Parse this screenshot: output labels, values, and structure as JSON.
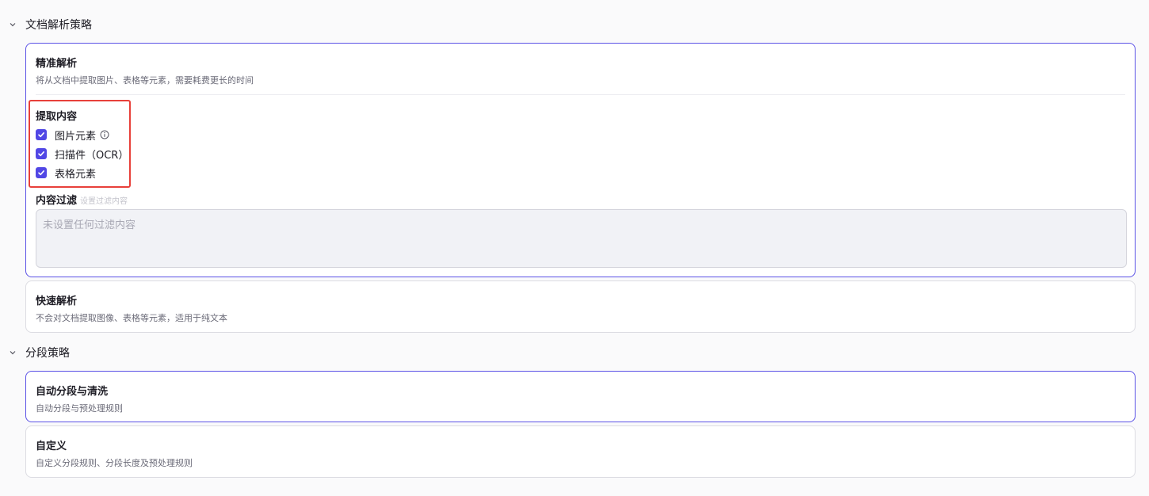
{
  "parse_section": {
    "title": "文档解析策略",
    "precise": {
      "title": "精准解析",
      "desc": "将从文档中提取图片、表格等元素，需要耗费更长的时间",
      "extract": {
        "title": "提取内容",
        "options": [
          {
            "label": "图片元素",
            "checked": true
          },
          {
            "label": "扫描件（OCR）",
            "checked": true
          },
          {
            "label": "表格元素",
            "checked": true
          }
        ]
      },
      "filter": {
        "title": "内容过滤",
        "hint": "设置过滤内容",
        "placeholder": "未设置任何过滤内容"
      }
    },
    "fast": {
      "title": "快速解析",
      "desc": "不会对文档提取图像、表格等元素，适用于纯文本"
    }
  },
  "segment_section": {
    "title": "分段策略",
    "auto": {
      "title": "自动分段与清洗",
      "desc": "自动分段与预处理规则"
    },
    "custom": {
      "title": "自定义",
      "desc": "自定义分段规则、分段长度及预处理规则"
    }
  },
  "colors": {
    "accent": "#5147e5",
    "selected_border": "#5b52e6",
    "highlight": "#e8403a"
  }
}
